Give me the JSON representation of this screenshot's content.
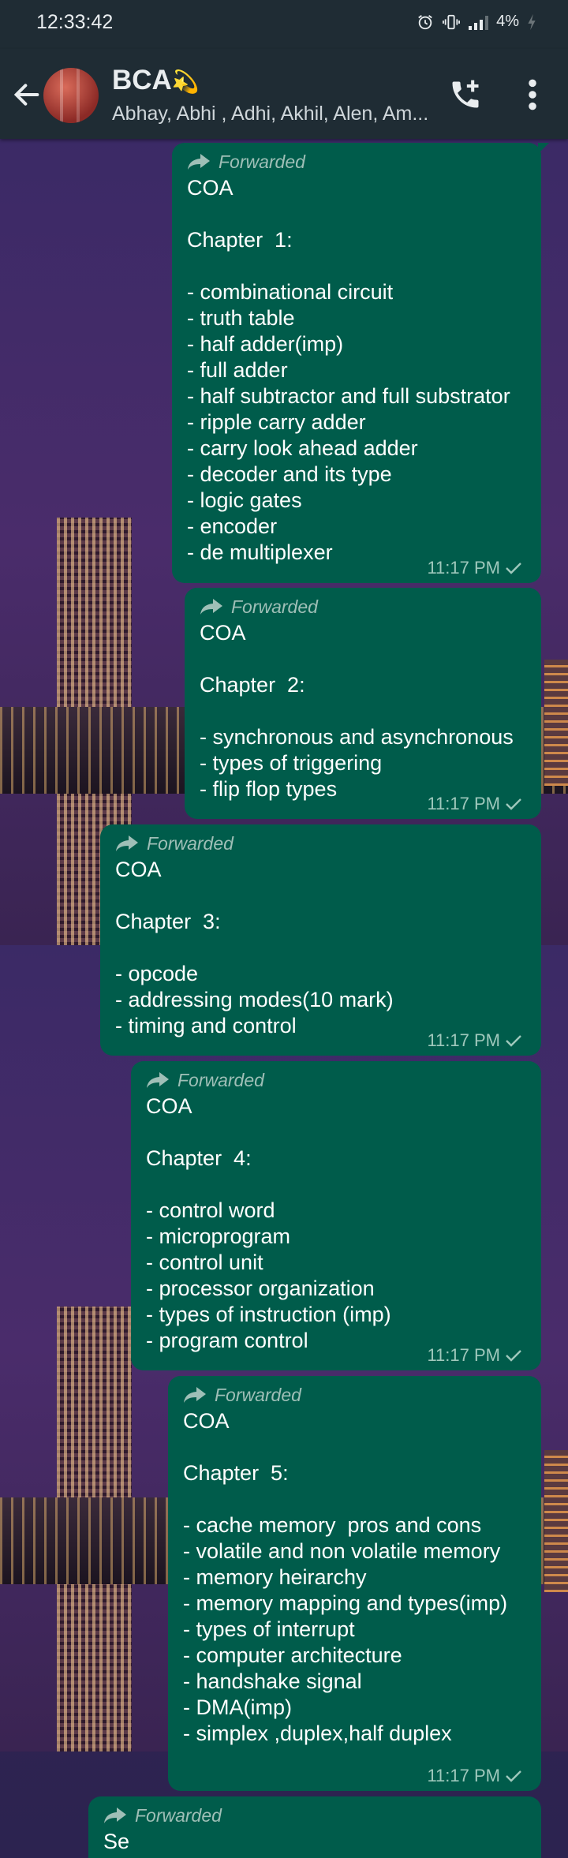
{
  "status_bar": {
    "time": "12:33:42",
    "battery": "4%"
  },
  "header": {
    "title": "BCA",
    "title_emoji": "💫",
    "subtitle": "Abhay, Abhi , Adhi, Akhil, Alen, Am...",
    "back_icon": "arrow-left-icon",
    "call_icon": "call-add-icon",
    "menu_icon": "more-vert-icon"
  },
  "colors": {
    "bubble": "#005c4b",
    "header": "#1f2c34",
    "meta_text": "#9fc8bc"
  },
  "messages": [
    {
      "forwarded_label": "Forwarded",
      "text": "COA\n\nChapter  1:\n\n- combinational circuit\n- truth table\n- half adder(imp)\n- full adder\n- half subtractor and full substrator\n- ripple carry adder\n- carry look ahead adder\n- decoder and its type\n- logic gates\n- encoder\n- de multiplexer",
      "time": "11:17 PM"
    },
    {
      "forwarded_label": "Forwarded",
      "text": "COA\n\nChapter  2:\n\n- synchronous and asynchronous\n- types of triggering\n- flip flop types",
      "time": "11:17 PM"
    },
    {
      "forwarded_label": "Forwarded",
      "text": "COA\n\nChapter  3:\n\n- opcode\n- addressing modes(10 mark)\n- timing and control",
      "time": "11:17 PM"
    },
    {
      "forwarded_label": "Forwarded",
      "text": "COA\n\nChapter  4:\n\n- control word\n- microprogram\n- control unit\n- processor organization\n- types of instruction (imp)\n- program control",
      "time": "11:17 PM"
    },
    {
      "forwarded_label": "Forwarded",
      "text": "COA\n\nChapter  5:\n\n- cache memory  pros and cons\n- volatile and non volatile memory\n- memory heirarchy\n- memory mapping and types(imp)\n- types of interrupt\n- computer architecture\n- handshake signal\n- DMA(imp)\n- simplex ,duplex,half duplex",
      "time": "11:17 PM"
    },
    {
      "forwarded_label": "Forwarded",
      "text": "Se"
    }
  ]
}
